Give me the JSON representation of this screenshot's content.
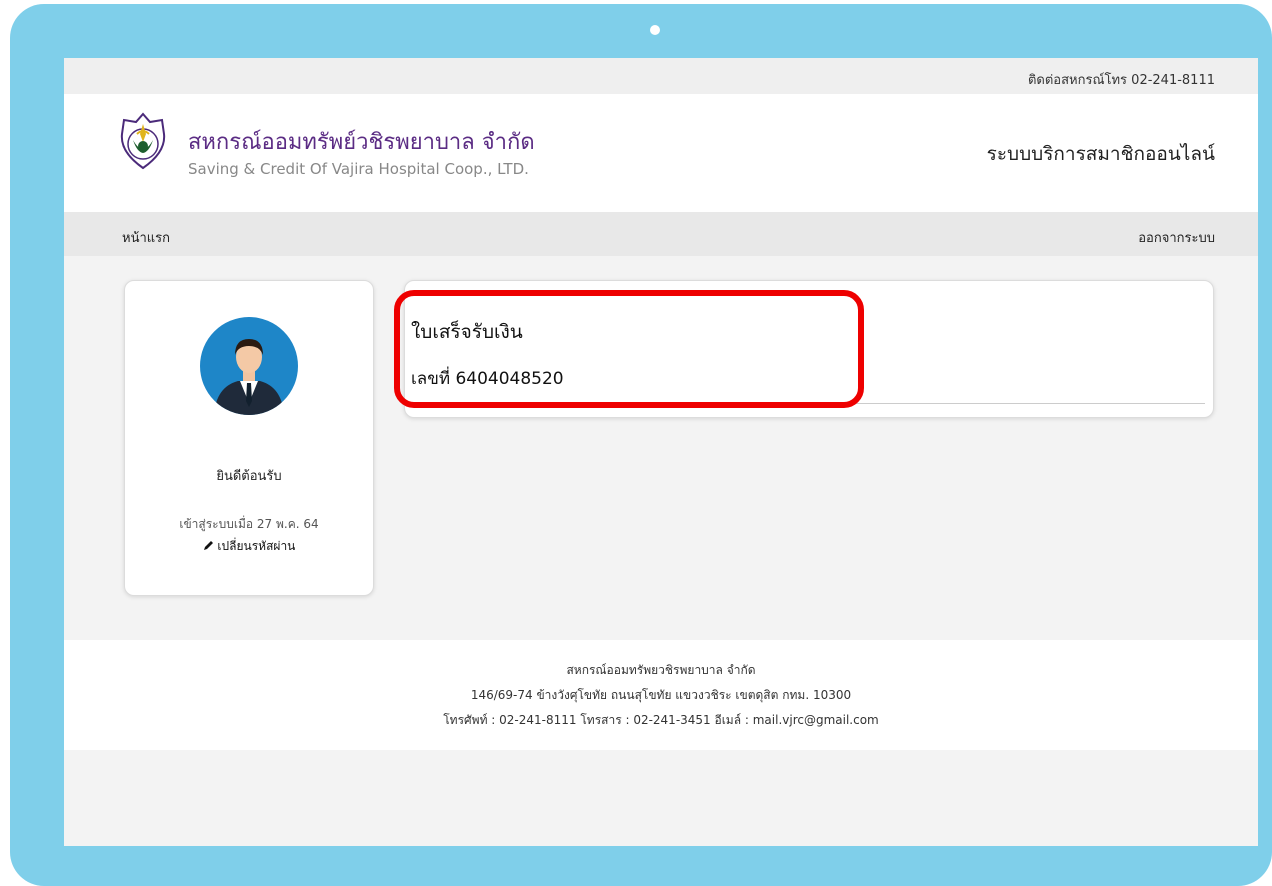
{
  "topbar": {
    "contact": "ติดต่อสหกรณ์โทร 02-241-8111"
  },
  "header": {
    "org_name_th": "สหกรณ์ออมทรัพย์วชิรพยาบาล จำกัด",
    "org_name_en": "Saving & Credit Of Vajira Hospital Coop., LTD.",
    "system_title": "ระบบบริการสมาชิกออนไลน์",
    "logo_icon": "coop-emblem-icon"
  },
  "nav": {
    "home": "หน้าแรก",
    "logout": "ออกจากระบบ"
  },
  "profile": {
    "avatar_icon": "user-avatar-icon",
    "welcome": "ยินดีต้อนรับ",
    "login_info": "เข้าสู่ระบบเมื่อ 27 พ.ค. 64",
    "change_password": "เปลี่ยนรหัสผ่าน",
    "change_password_icon": "pencil-icon"
  },
  "receipt": {
    "title": "ใบเสร็จรับเงิน",
    "number": "เลขที่ 6404048520"
  },
  "footer": {
    "line1": "สหกรณ์ออมทรัพยวชิรพยาบาล จำกัด",
    "line2": "146/69-74 ข้างวังศุโขทัย ถนนสุโขทัย แขวงวชิระ เขตดุสิต กทม. 10300",
    "line3": "โทรศัพท์ : 02-241-8111 โทรสาร : 02-241-3451 อีเมล์ : mail.vjrc@gmail.com"
  },
  "colors": {
    "device_frame": "#7fcfea",
    "brand_purple": "#5b2c84",
    "highlight_red": "#ee0000"
  }
}
